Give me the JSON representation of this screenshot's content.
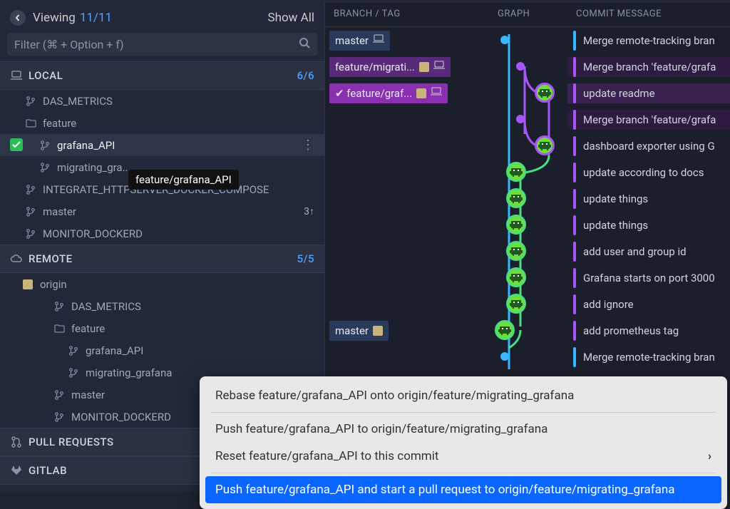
{
  "sidebar": {
    "viewing_label": "Viewing",
    "viewing_count": "11/11",
    "show_all": "Show All",
    "filter_placeholder": "Filter (⌘ + Option + f)",
    "local": {
      "label": "LOCAL",
      "count": "6/6",
      "items": [
        {
          "label": "DAS_METRICS",
          "type": "branch",
          "indent": 1
        },
        {
          "label": "feature",
          "type": "folder",
          "indent": 1
        },
        {
          "label": "grafana_API",
          "type": "branch",
          "indent": 2,
          "selected": true,
          "checked": true
        },
        {
          "label": "migrating_gra...",
          "type": "branch",
          "indent": 2
        },
        {
          "label": "INTEGRATE_HTTPSERVER_DOCKER_COMPOSE",
          "type": "branch",
          "indent": 1
        },
        {
          "label": "master",
          "type": "branch",
          "indent": 1,
          "badge": "3↑"
        },
        {
          "label": "MONITOR_DOCKERD",
          "type": "branch",
          "indent": 1
        }
      ]
    },
    "remote": {
      "label": "REMOTE",
      "count": "5/5",
      "origin_label": "origin",
      "items": [
        {
          "label": "DAS_METRICS",
          "type": "branch",
          "indent": 2
        },
        {
          "label": "feature",
          "type": "folder",
          "indent": 2
        },
        {
          "label": "grafana_API",
          "type": "branch",
          "indent": 3
        },
        {
          "label": "migrating_grafana",
          "type": "branch",
          "indent": 3
        },
        {
          "label": "master",
          "type": "branch",
          "indent": 2
        },
        {
          "label": "MONITOR_DOCKERD",
          "type": "branch",
          "indent": 2
        }
      ]
    },
    "pull_requests": "PULL REQUESTS",
    "gitlab": "GITLAB"
  },
  "tooltip": "feature/grafana_API",
  "columns": {
    "branch": "BRANCH  /  TAG",
    "graph": "GRAPH",
    "message": "COMMIT MESSAGE"
  },
  "commits": [
    {
      "pill": "master",
      "pill_class": "pill-master",
      "pill_icons": [
        "laptop"
      ],
      "msg": "Merge remote-tracking bran",
      "bar": "bar-blue",
      "graph": "blue-dot"
    },
    {
      "pill": "feature/migrati...",
      "pill_class": "pill-feature",
      "pill_icons": [
        "square",
        "laptop"
      ],
      "msg": "Merge branch 'feature/grafa",
      "bar": "bar-purple",
      "graph": "purple-dot",
      "row_tone": "row-highlight2"
    },
    {
      "pill": "✔ feature/graf...",
      "pill_class": "pill-feature-active",
      "pill_icons": [
        "square",
        "laptop"
      ],
      "msg": "update readme",
      "bar": "bar-purple",
      "graph": "av-green-p",
      "row_tone": "row-highlight"
    },
    {
      "msg": "Merge branch 'feature/grafa",
      "bar": "bar-purple",
      "graph": "purple-dot",
      "row_tone": "row-highlight2"
    },
    {
      "msg": "dashboard exporter using G",
      "bar": "bar-purple",
      "graph": "av-green-p"
    },
    {
      "msg": "update according to docs",
      "bar": "bar-purple",
      "graph": "av-green-g"
    },
    {
      "msg": "update things",
      "bar": "bar-purple",
      "graph": "av-green-g"
    },
    {
      "msg": "update things",
      "bar": "bar-purple",
      "graph": "av-green-g"
    },
    {
      "msg": "add user and group id",
      "bar": "bar-purple",
      "graph": "av-green-g"
    },
    {
      "msg": "Grafana starts on port 3000",
      "bar": "bar-purple",
      "graph": "av-green-g"
    },
    {
      "msg": "add ignore",
      "bar": "bar-purple",
      "graph": "av-green-g"
    },
    {
      "pill": "master",
      "pill_class": "pill-master-dark",
      "pill_icons": [
        "square"
      ],
      "msg": "add prometheus tag",
      "bar": "bar-purple",
      "graph": "av-green-g-shift"
    },
    {
      "msg": "Merge remote-tracking bran",
      "bar": "bar-blue",
      "graph": "blue-dot"
    }
  ],
  "context_menu": {
    "items": [
      {
        "label": "Rebase feature/grafana_API onto origin/feature/migrating_grafana"
      },
      {
        "sep": true
      },
      {
        "label": "Push feature/grafana_API to origin/feature/migrating_grafana"
      },
      {
        "label": "Reset feature/grafana_API to this commit",
        "chevron": true
      },
      {
        "sep": true
      },
      {
        "label": "Push feature/grafana_API and start a pull request to origin/feature/migrating_grafana",
        "highlighted": true
      }
    ]
  }
}
